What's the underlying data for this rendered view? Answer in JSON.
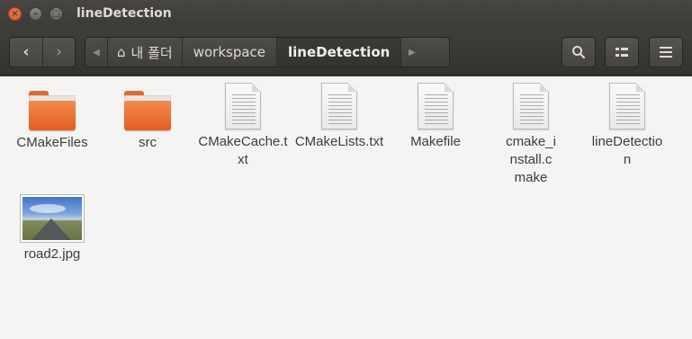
{
  "window": {
    "title": "lineDetection",
    "close_glyph": "×",
    "min_glyph": "–",
    "max_glyph": "□"
  },
  "toolbar": {
    "back_icon": "‹",
    "forward_icon": "›",
    "path_left_arrow": "◀",
    "path_right_arrow": "▶",
    "home_icon": "⌂",
    "breadcrumbs": [
      "내 폴더",
      "workspace",
      "lineDetection"
    ],
    "search_icon": "🔍",
    "view_icon": "☷",
    "menu_icon": "≡"
  },
  "files": [
    {
      "name": "CMakeFiles",
      "type": "folder"
    },
    {
      "name": "src",
      "type": "folder"
    },
    {
      "name": "CMakeCache.txt",
      "type": "text"
    },
    {
      "name": "CMakeLists.txt",
      "type": "text"
    },
    {
      "name": "Makefile",
      "type": "text"
    },
    {
      "name": "cmake_install.cmake",
      "type": "text"
    },
    {
      "name": "lineDetection",
      "type": "text"
    },
    {
      "name": "road2.jpg",
      "type": "image"
    }
  ],
  "colors": {
    "accent": "#e35d21",
    "background": "#f5f4f2",
    "chrome": "#3c3b37"
  }
}
